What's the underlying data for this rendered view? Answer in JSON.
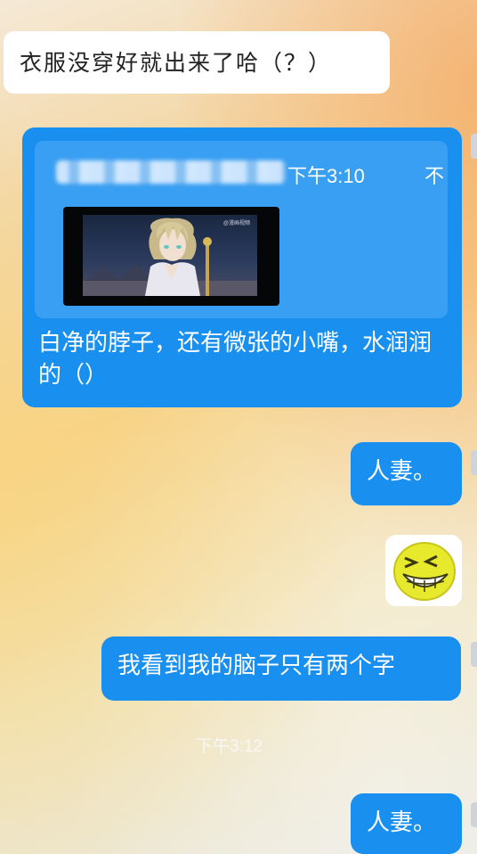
{
  "messages": {
    "incoming_1": "衣服没穿好就出来了哈（？）",
    "quote": {
      "time": "下午3:10",
      "caret": "不",
      "video_watermark": "@漫画视频",
      "text": "白净的脖子，还有微张的小嘴，水润润的（）"
    },
    "outgoing_1": "人妻。",
    "outgoing_2": "我看到我的脑子只有两个字",
    "timestamp": "下午3:12",
    "outgoing_3": "人妻。"
  },
  "colors": {
    "bubble_blue": "#1990f0",
    "bubble_white": "#ffffff"
  },
  "icons": {
    "sticker": "grinning-laughing-emoji"
  }
}
